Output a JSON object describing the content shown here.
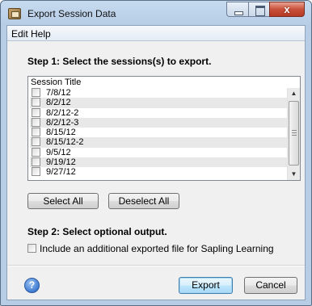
{
  "window": {
    "title": "Export Session Data",
    "close_glyph": "x"
  },
  "menu": [
    "Edit",
    "Help"
  ],
  "step1": {
    "title": "Step 1: Select the sessions(s) to export."
  },
  "session_list": {
    "column_header": "Session Title",
    "rows": [
      "7/8/12",
      "8/2/12",
      "8/2/12-2",
      "8/2/12-3",
      "8/15/12",
      "8/15/12-2",
      "9/5/12",
      "9/19/12",
      "9/27/12"
    ]
  },
  "buttons": {
    "select_all": "Select All",
    "deselect_all": "Deselect All",
    "export": "Export",
    "cancel": "Cancel"
  },
  "step2": {
    "title": "Step 2: Select optional output.",
    "option_label": "Include an additional exported file for Sapling Learning"
  },
  "help_glyph": "?",
  "icons": {
    "app": "export-app-icon",
    "minimize": "minimize-icon",
    "maximize": "maximize-icon",
    "close": "close-icon",
    "help": "help-icon",
    "scroll_up": "scroll-up-arrow-icon",
    "scroll_down": "scroll-down-arrow-icon"
  },
  "colors": {
    "titlebar": "#b7cde6",
    "dialog_bg": "#f0f0f0",
    "close_button": "#c9503a",
    "default_button_border": "#3c7fb1"
  }
}
